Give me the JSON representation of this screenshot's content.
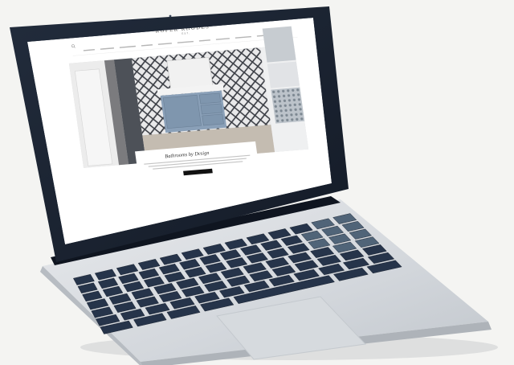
{
  "site": {
    "logo": "ROPER RHODES",
    "logo_sub": "EST.",
    "top_links": [
      "",
      ""
    ],
    "search_label": "",
    "nav_items": [
      "",
      "",
      "",
      "",
      "",
      "",
      "",
      "",
      "",
      "",
      ""
    ]
  },
  "hero": {
    "title": "Bathrooms by Design",
    "cta_label": ""
  },
  "colors": {
    "laptop_bezel": "#1b2433",
    "laptop_body": "#dcdfe3",
    "key": "#26344a",
    "key_light": "#506478",
    "vanity": "#8aa0b8"
  },
  "icons": [
    "search-icon",
    "account-icon",
    "basket-icon"
  ]
}
